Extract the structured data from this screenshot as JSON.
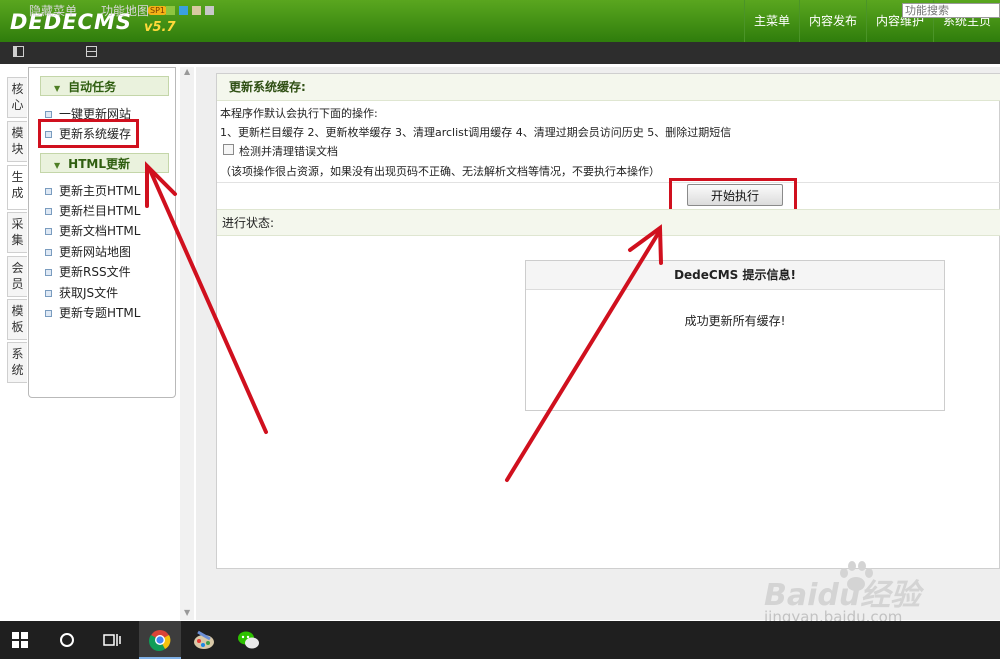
{
  "header": {
    "logo_text": "DEDECMS",
    "version": "v5.7",
    "sp_badge": "SP1",
    "nav": [
      "主菜单",
      "内容发布",
      "内容维护",
      "系统主页"
    ]
  },
  "toolbar": {
    "hide_menu": "隐藏菜单",
    "site_map": "功能地图",
    "search_placeholder": "功能搜索",
    "swatch_colors": [
      "#8ec63f",
      "#3aa0e0",
      "#d8c9a0",
      "#c8c8c8"
    ]
  },
  "vertical_tabs": [
    "核\n心",
    "模\n块",
    "生\n成",
    "采\n集",
    "会\n员",
    "模\n板",
    "系\n统"
  ],
  "sidebar": {
    "group1_title": "自动任务",
    "group1_items": [
      "一键更新网站",
      "更新系统缓存"
    ],
    "group2_title": "HTML更新",
    "group2_items": [
      "更新主页HTML",
      "更新栏目HTML",
      "更新文档HTML",
      "更新网站地图",
      "更新RSS文件",
      "获取JS文件",
      "更新专题HTML"
    ]
  },
  "main": {
    "section_title": "更新系统缓存:",
    "intro": "本程序作默认会执行下面的操作:",
    "operations": "1、更新栏目缓存 2、更新枚举缓存 3、清理arclist调用缓存 4、清理过期会员访问历史 5、删除过期短信",
    "checkbox_label": "检测并清理错误文档",
    "warning": "（该项操作很占资源，如果没有出现页码不正确、无法解析文档等情况，不要执行本操作）",
    "exec_button": "开始执行",
    "status_label": "进行状态:"
  },
  "message_box": {
    "title": "DedeCMS 提示信息!",
    "body": "成功更新所有缓存!"
  },
  "watermark": {
    "brand": "Baidu经验",
    "url": "jingyan.baidu.com"
  },
  "annotation_color": "#d0101e",
  "taskbar": {
    "icons": [
      "windows-start-icon",
      "search-circle-icon",
      "task-view-icon",
      "chrome-icon",
      "paint-icon",
      "wechat-icon"
    ]
  }
}
